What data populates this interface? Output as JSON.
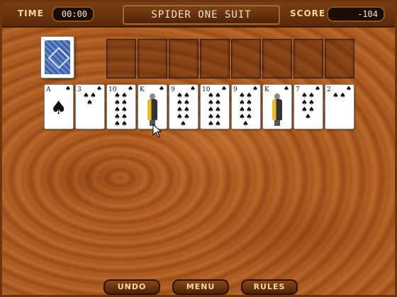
{
  "hud": {
    "time_label": "TIME",
    "time_value": "00:00",
    "title": "SPIDER ONE SUIT",
    "score_label": "SCORE",
    "score_value": "-104"
  },
  "tableau": [
    {
      "rank": "A",
      "suit": "♠"
    },
    {
      "rank": "3",
      "suit": "♠"
    },
    {
      "rank": "10",
      "suit": "♠"
    },
    {
      "rank": "K",
      "suit": "♠"
    },
    {
      "rank": "9",
      "suit": "♠"
    },
    {
      "rank": "10",
      "suit": "♠"
    },
    {
      "rank": "9",
      "suit": "♠"
    },
    {
      "rank": "K",
      "suit": "♠"
    },
    {
      "rank": "7",
      "suit": "♠"
    },
    {
      "rank": "2",
      "suit": "♠"
    }
  ],
  "foundation_slots": 8,
  "buttons": {
    "undo": "UNDO",
    "menu": "MENU",
    "rules": "RULES"
  },
  "colors": {
    "felt_wood": "#aa5a22",
    "card_back": "#3e5ea6",
    "hud_text": "#f2d9a0"
  }
}
